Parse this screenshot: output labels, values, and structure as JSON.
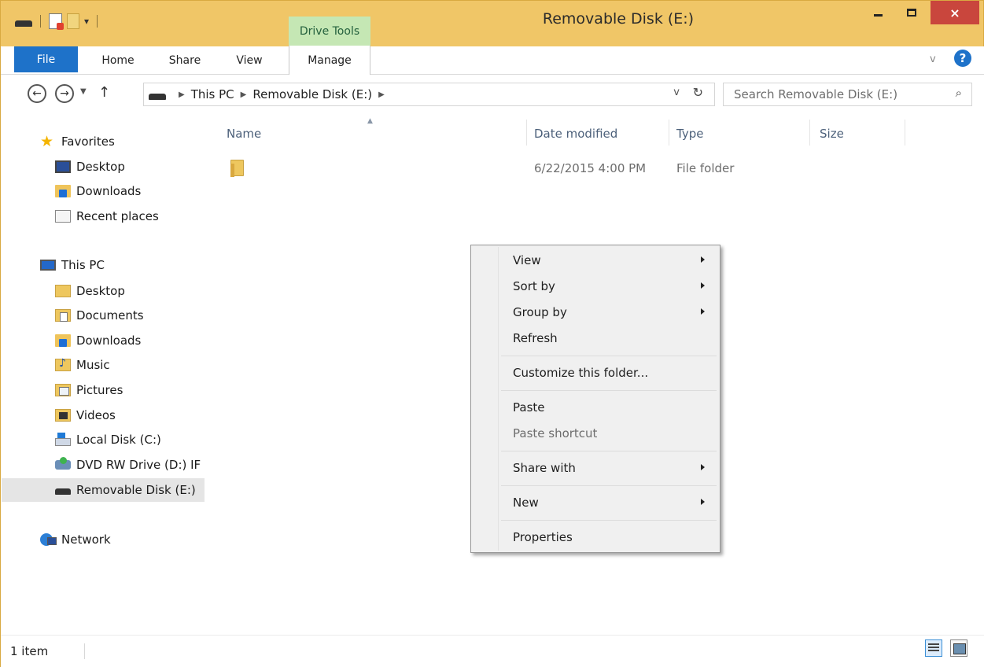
{
  "window": {
    "title": "Removable Disk (E:)",
    "context_tab_group": "Drive Tools",
    "close_label": "×"
  },
  "ribbon": {
    "tabs": [
      "File",
      "Home",
      "Share",
      "View",
      "Manage"
    ]
  },
  "address": {
    "crumbs": [
      "This PC",
      "Removable Disk (E:)"
    ],
    "search_placeholder": "Search Removable Disk (E:)"
  },
  "nav": {
    "favorites": {
      "label": "Favorites",
      "items": [
        "Desktop",
        "Downloads",
        "Recent places"
      ]
    },
    "this_pc": {
      "label": "This PC",
      "items": [
        "Desktop",
        "Documents",
        "Downloads",
        "Music",
        "Pictures",
        "Videos",
        "Local Disk (C:)",
        "DVD RW Drive (D:) IF",
        "Removable Disk (E:)"
      ]
    },
    "network": "Network"
  },
  "list": {
    "columns": [
      "Name",
      "Date modified",
      "Type",
      "Size"
    ],
    "rows": [
      {
        "name": "",
        "date_modified": "6/22/2015 4:00 PM",
        "type": "File folder",
        "size": ""
      }
    ]
  },
  "context_menu": {
    "items": [
      {
        "label": "View",
        "submenu": true,
        "enabled": true
      },
      {
        "label": "Sort by",
        "submenu": true,
        "enabled": true
      },
      {
        "label": "Group by",
        "submenu": true,
        "enabled": true
      },
      {
        "label": "Refresh",
        "submenu": false,
        "enabled": true
      },
      {
        "label": "Customize this folder...",
        "submenu": false,
        "enabled": true
      },
      {
        "label": "Paste",
        "submenu": false,
        "enabled": true
      },
      {
        "label": "Paste shortcut",
        "submenu": false,
        "enabled": false
      },
      {
        "label": "Share with",
        "submenu": true,
        "enabled": true
      },
      {
        "label": "New",
        "submenu": true,
        "enabled": true
      },
      {
        "label": "Properties",
        "submenu": false,
        "enabled": true
      }
    ]
  },
  "status": {
    "item_count": "1 item"
  },
  "colors": {
    "title_bar": "#f0c667",
    "file_tab": "#1e72c9",
    "drive_tools": "#c5e7b4",
    "close_button": "#c9463d"
  }
}
